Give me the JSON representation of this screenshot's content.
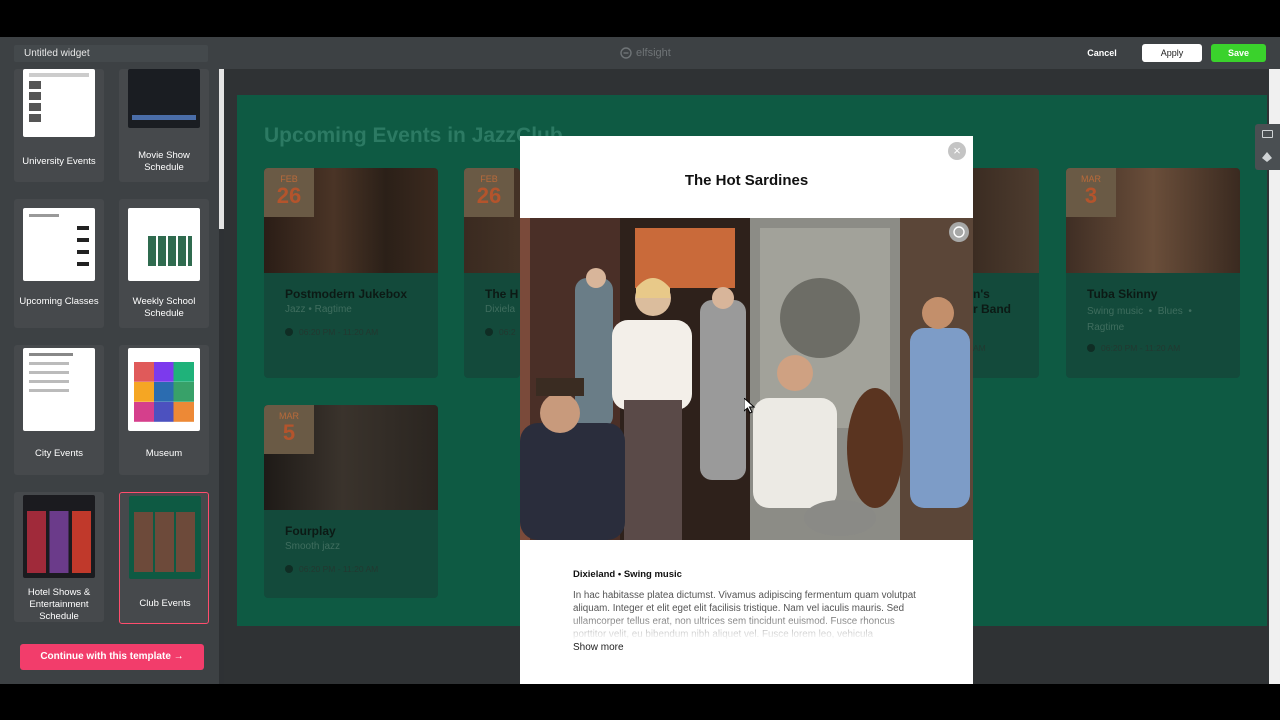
{
  "editor": {
    "widget_name": "Untitled widget",
    "logo_text": "elfsight",
    "cancel_label": "Cancel",
    "apply_label": "Apply",
    "save_label": "Save"
  },
  "sidebar": {
    "templates": [
      {
        "label": "University Events"
      },
      {
        "label": "Movie Show Schedule"
      },
      {
        "label": "Upcoming Classes"
      },
      {
        "label": "Weekly School Schedule"
      },
      {
        "label": "City Events"
      },
      {
        "label": "Museum"
      },
      {
        "label": "Hotel Shows & Entertainment Schedule"
      },
      {
        "label": "Club Events",
        "selected": true
      }
    ],
    "continue_label": "Continue with this template →"
  },
  "preview": {
    "title": "Upcoming Events in JazzClub",
    "cards": [
      {
        "month": "FEB",
        "day": "26",
        "name": "Postmodern Jukebox",
        "genre": "Jazz  •  Ragtime",
        "time": "06:20 PM - 11:20 AM"
      },
      {
        "month": "FEB",
        "day": "26",
        "name": "The H",
        "genre": "Dixiela",
        "time": "06:2"
      },
      {
        "month": "",
        "day": "",
        "name": "n's\nr Band",
        "genre": "",
        "time": "AM"
      },
      {
        "month": "MAR",
        "day": "3",
        "name": "Tuba Skinny",
        "genre": "Swing music  •  Blues  •\nRagtime",
        "time": "06:20 PM - 11:20 AM"
      },
      {
        "month": "MAR",
        "day": "5",
        "name": "Fourplay",
        "genre": "Smooth jazz",
        "time": "06:20 PM - 11:20 AM"
      }
    ]
  },
  "modal": {
    "title": "The Hot Sardines",
    "tags": "Dixieland  •  Swing music",
    "description": "In hac habitasse platea dictumst. Vivamus adipiscing fermentum quam volutpat aliquam. Integer et elit eget elit facilisis tristique. Nam vel iaculis mauris. Sed ullamcorper tellus erat, non ultrices sem tincidunt euismod. Fusce rhoncus porttitor velit, eu bibendum nibh aliquet vel. Fusce lorem leo, vehicula",
    "show_more_label": "Show more"
  }
}
